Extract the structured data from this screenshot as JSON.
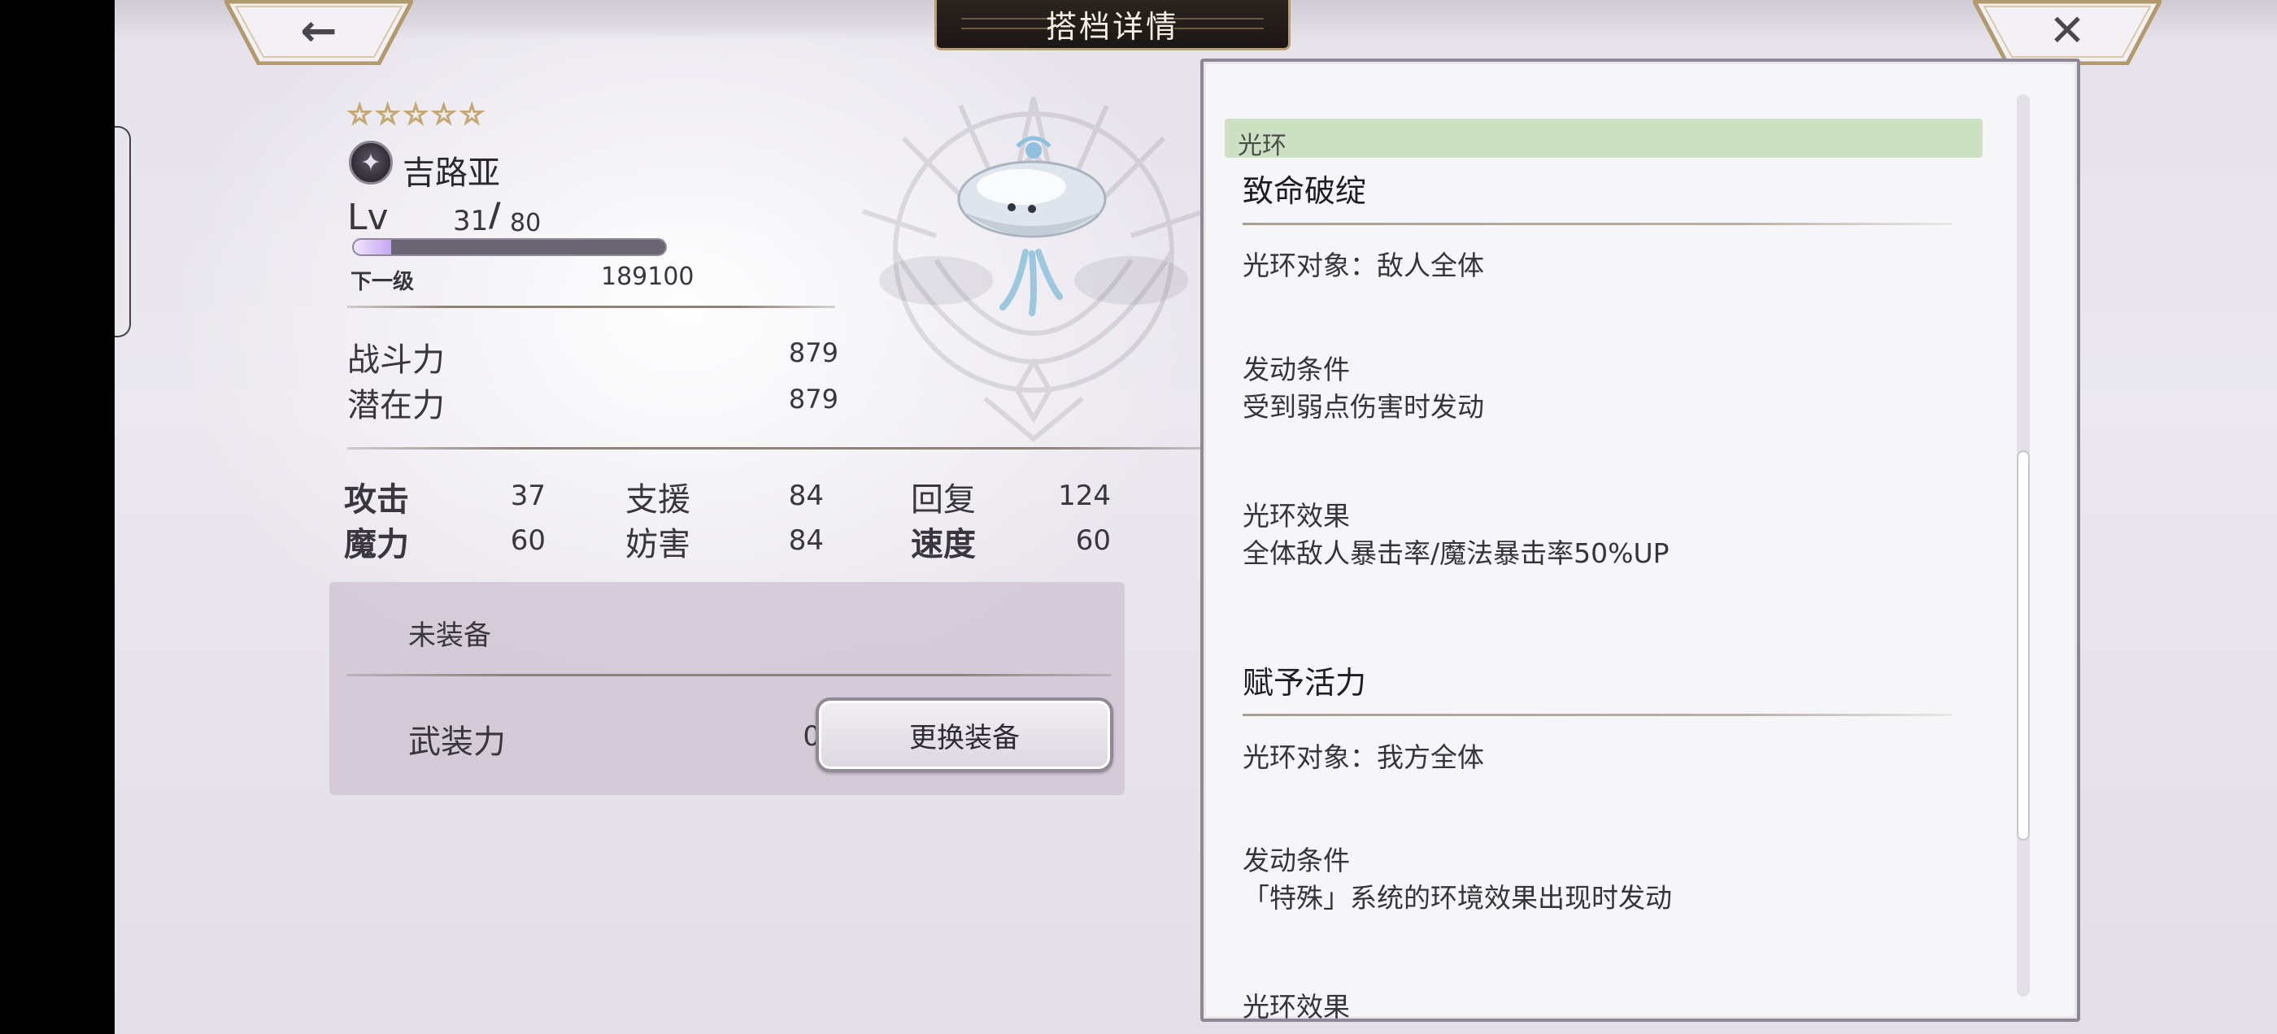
{
  "header": {
    "title": "搭档详情",
    "back_icon": "←",
    "close_icon": "✕"
  },
  "partner": {
    "stars": 5,
    "star_glyph": "☆",
    "element_glyph": "✦",
    "name": "吉路亚",
    "level_label": "Lv",
    "level_current": "31",
    "level_slash": "/",
    "level_max": "80",
    "exp_fill_fraction": 0.12,
    "next_level_label": "下一级",
    "next_level_value": "189100",
    "combat_power_label": "战斗力",
    "combat_power_value": "879",
    "potential_label": "潜在力",
    "potential_value": "879"
  },
  "attributes": {
    "attack_label": "攻击",
    "attack_value": "37",
    "support_label": "支援",
    "support_value": "84",
    "recovery_label": "回复",
    "recovery_value": "124",
    "magic_label": "魔力",
    "magic_value": "60",
    "hinder_label": "妨害",
    "hinder_value": "84",
    "speed_label": "速度",
    "speed_value": "60"
  },
  "equipment": {
    "status": "未装备",
    "armed_power_label": "武装力",
    "armed_power_value": "0",
    "change_button_label": "更换装备"
  },
  "aura": {
    "section_label": "光环",
    "skills": [
      {
        "name": "致命破绽",
        "target": "光环对象：敌人全体",
        "condition_label": "发动条件",
        "condition": "受到弱点伤害时发动",
        "effect_label": "光环效果",
        "effect": "全体敌人暴击率/魔法暴击率50%UP"
      },
      {
        "name": "赋予活力",
        "target": "光环对象：我方全体",
        "condition_label": "发动条件",
        "condition": "「特殊」系统的环境效果出现时发动",
        "effect_label": "光环效果"
      }
    ]
  },
  "colors": {
    "aura_header": "#cde0c4",
    "title_plate": "#1c1714",
    "title_border": "#b79f74"
  }
}
